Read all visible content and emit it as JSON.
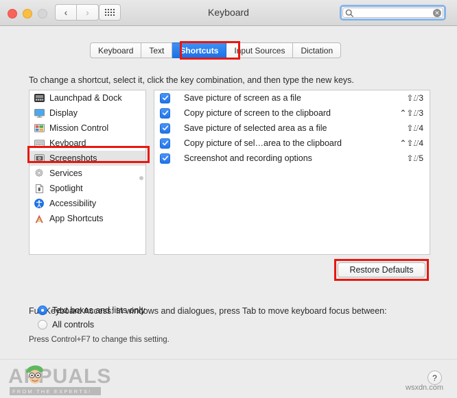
{
  "window": {
    "title": "Keyboard",
    "traffic_lights": [
      "close-button",
      "minimize-button",
      "zoom-button"
    ],
    "back_glyph": "‹",
    "forward_glyph": "›",
    "grid_button_name": "show-all-button"
  },
  "search": {
    "value": "",
    "placeholder": "",
    "clear_glyph": "✕"
  },
  "tabs": [
    {
      "label": "Keyboard",
      "selected": false
    },
    {
      "label": "Text",
      "selected": false
    },
    {
      "label": "Shortcuts",
      "selected": true
    },
    {
      "label": "Input Sources",
      "selected": false
    },
    {
      "label": "Dictation",
      "selected": false
    }
  ],
  "instruction": "To change a shortcut, select it, click the key combination, and then type the new keys.",
  "sidebar": {
    "items": [
      {
        "label": "Launchpad & Dock",
        "icon": "launchpad-dock-icon",
        "selected": false
      },
      {
        "label": "Display",
        "icon": "display-icon",
        "selected": false
      },
      {
        "label": "Mission Control",
        "icon": "mission-control-icon",
        "selected": false
      },
      {
        "label": "Keyboard",
        "icon": "keyboard-icon",
        "selected": false
      },
      {
        "label": "Screenshots",
        "icon": "screenshots-icon",
        "selected": true
      },
      {
        "label": "Services",
        "icon": "services-gear-icon",
        "selected": false
      },
      {
        "label": "Spotlight",
        "icon": "spotlight-icon",
        "selected": false
      },
      {
        "label": "Accessibility",
        "icon": "accessibility-icon",
        "selected": false
      },
      {
        "label": "App Shortcuts",
        "icon": "app-shortcuts-icon",
        "selected": false
      }
    ]
  },
  "shortcuts": [
    {
      "checked": true,
      "label": "Save picture of screen as a file",
      "keys": "⇧⌰3"
    },
    {
      "checked": true,
      "label": "Copy picture of screen to the clipboard",
      "keys": "⌃⇧⌰3"
    },
    {
      "checked": true,
      "label": "Save picture of selected area as a file",
      "keys": "⇧⌰4"
    },
    {
      "checked": true,
      "label": "Copy picture of sel…area to the clipboard",
      "keys": "⌃⇧⌰4"
    },
    {
      "checked": true,
      "label": "Screenshot and recording options",
      "keys": "⇧⌰5"
    }
  ],
  "restore_defaults_label": "Restore Defaults",
  "full_keyboard_access": {
    "label": "Full Keyboard Access: In windows and dialogues, press Tab to move keyboard focus between:",
    "options": [
      {
        "label": "Text boxes and lists only",
        "selected": true
      },
      {
        "label": "All controls",
        "selected": false
      }
    ],
    "hint": "Press Control+F7 to change this setting."
  },
  "footer": {
    "logo_word": "APPUALS",
    "logo_tagline": "FROM THE EXPERTS!",
    "help_glyph": "?",
    "watermark": "wsxdn.com"
  },
  "colors": {
    "accent_blue": "#1f74ec",
    "annotation_red": "#e8170f",
    "window_bg": "#ececec"
  }
}
